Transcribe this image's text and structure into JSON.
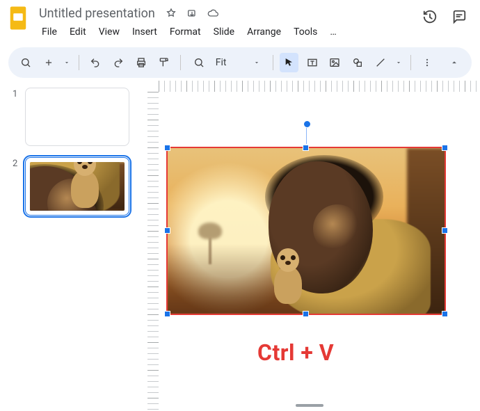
{
  "app": {
    "title": "Untitled presentation"
  },
  "menu": {
    "file": "File",
    "edit": "Edit",
    "view": "View",
    "insert": "Insert",
    "format": "Format",
    "slide": "Slide",
    "arrange": "Arrange",
    "tools": "Tools",
    "more": "…"
  },
  "toolbar": {
    "zoom_label": "Fit"
  },
  "sidebar": {
    "thumbs": [
      {
        "num": "1",
        "selected": false
      },
      {
        "num": "2",
        "selected": true
      }
    ]
  },
  "annotation": {
    "text": "Ctrl + V"
  }
}
